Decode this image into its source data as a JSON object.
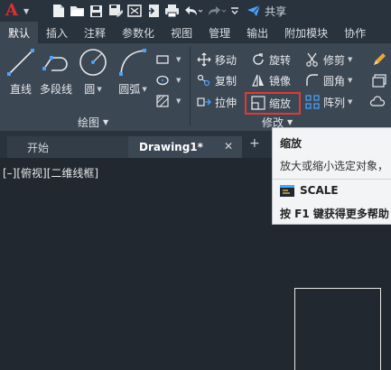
{
  "app": {
    "logo_letter": "A",
    "share_label": "共享"
  },
  "colors": {
    "ribbon_bg": "#3c4754",
    "dark_bg": "#29333e",
    "canvas_bg": "#212830",
    "highlight": "#e23a32",
    "logo": "#e0302c",
    "accent_blue": "#4aa3ff"
  },
  "quick_access": {
    "icons": [
      "new-file-icon",
      "open-folder-icon",
      "save-icon",
      "save-as-icon",
      "web-icon",
      "import-icon",
      "print-icon",
      "undo-icon",
      "redo-icon",
      "more-icon"
    ]
  },
  "ribbon_tabs": [
    {
      "label": "默认",
      "active": true
    },
    {
      "label": "插入"
    },
    {
      "label": "注释"
    },
    {
      "label": "参数化"
    },
    {
      "label": "视图"
    },
    {
      "label": "管理"
    },
    {
      "label": "输出"
    },
    {
      "label": "附加模块"
    },
    {
      "label": "协作"
    }
  ],
  "draw_panel": {
    "title": "绘图",
    "line": "直线",
    "polyline": "多段线",
    "circle": "圆",
    "arc": "圆弧"
  },
  "modify_panel": {
    "title": "修改",
    "move": "移动",
    "rotate": "旋转",
    "trim": "修剪",
    "copy": "复制",
    "mirror": "镜像",
    "fillet": "圆角",
    "stretch": "拉伸",
    "scale": "缩放",
    "array": "阵列"
  },
  "file_tabs": {
    "start": "开始",
    "drawing": "Drawing1*",
    "close": "✕",
    "add": "+"
  },
  "viewport": {
    "label": "[–][俯视][二维线框]"
  },
  "tooltip": {
    "title": "缩放",
    "description": "放大或缩小选定对象，",
    "command": "SCALE",
    "help": "按 F1 键获得更多帮助"
  }
}
